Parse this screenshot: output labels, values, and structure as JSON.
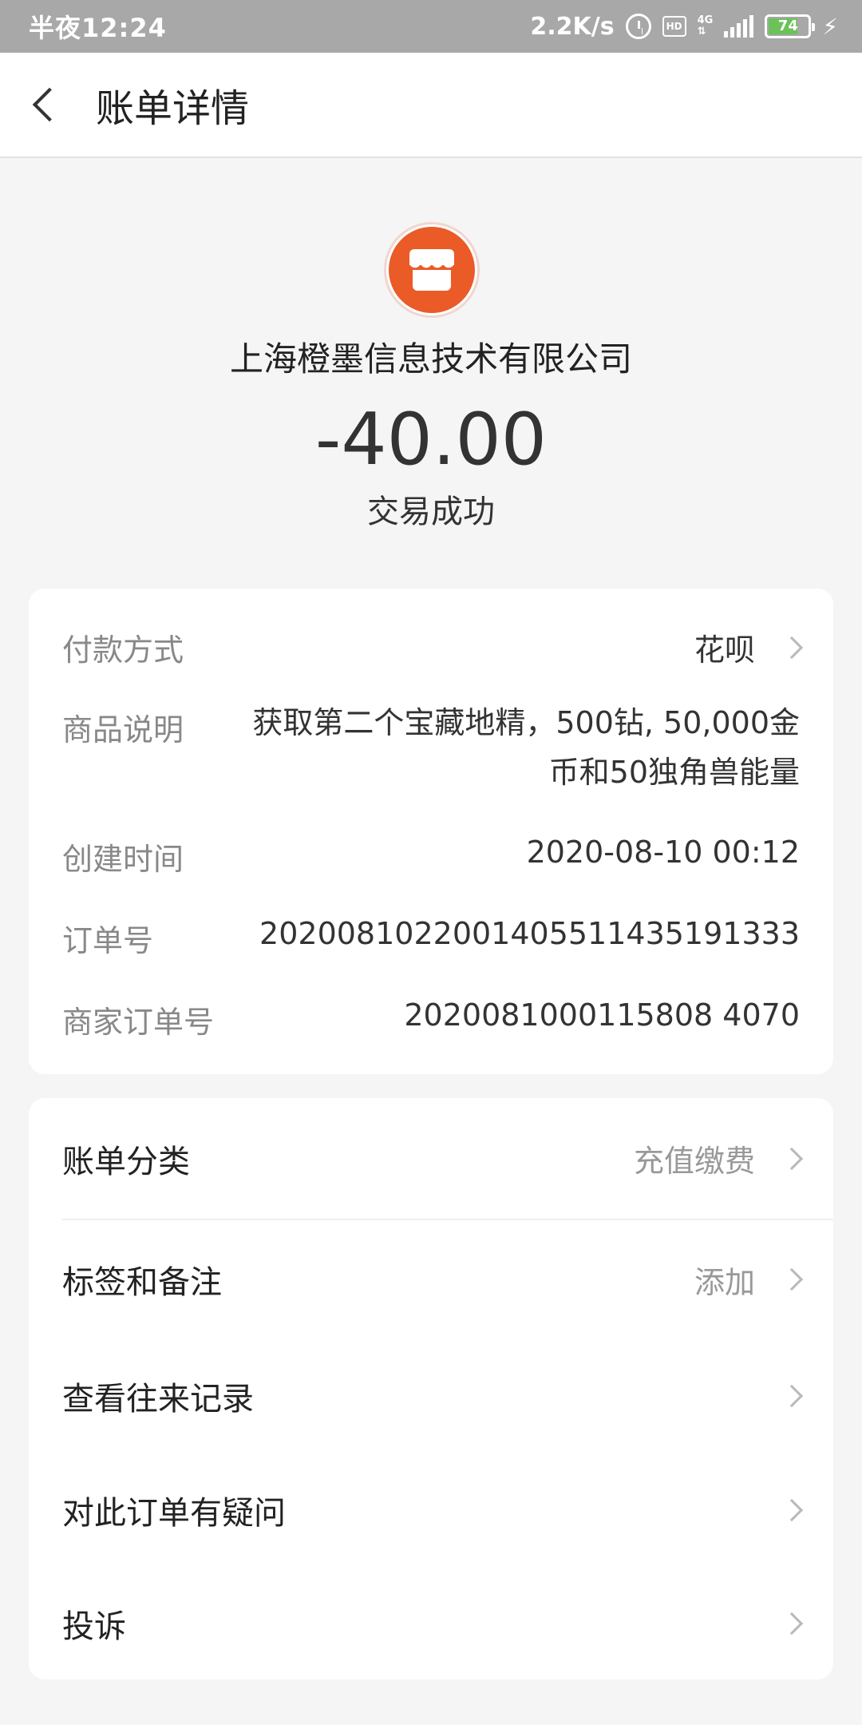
{
  "status_bar": {
    "time": "半夜12:24",
    "speed": "2.2K/s",
    "hd": "HD",
    "network": "4G",
    "battery": "74",
    "battery_level": 0.74
  },
  "header": {
    "title": "账单详情"
  },
  "summary": {
    "merchant": "上海橙墨信息技术有限公司",
    "amount": "-40.00",
    "status": "交易成功",
    "icon": "shop-icon",
    "accent_color": "#ea5b27"
  },
  "details": {
    "payment_method": {
      "label": "付款方式",
      "value": "花呗"
    },
    "product_desc": {
      "label": "商品说明",
      "value": "获取第二个宝藏地精，500钻, 50,000金币和50独角兽能量"
    },
    "created_time": {
      "label": "创建时间",
      "value": "2020-08-10 00:12"
    },
    "order_no": {
      "label": "订单号",
      "value": "2020081022001405511435191333"
    },
    "merchant_order_no": {
      "label": "商家订单号",
      "value": "2020081000115808 4070"
    }
  },
  "actions": {
    "category": {
      "label": "账单分类",
      "value": "充值缴费"
    },
    "tags": {
      "label": "标签和备注",
      "value": "添加"
    },
    "history": {
      "label": "查看往来记录"
    },
    "question": {
      "label": "对此订单有疑问"
    },
    "complaint": {
      "label": "投诉"
    }
  }
}
